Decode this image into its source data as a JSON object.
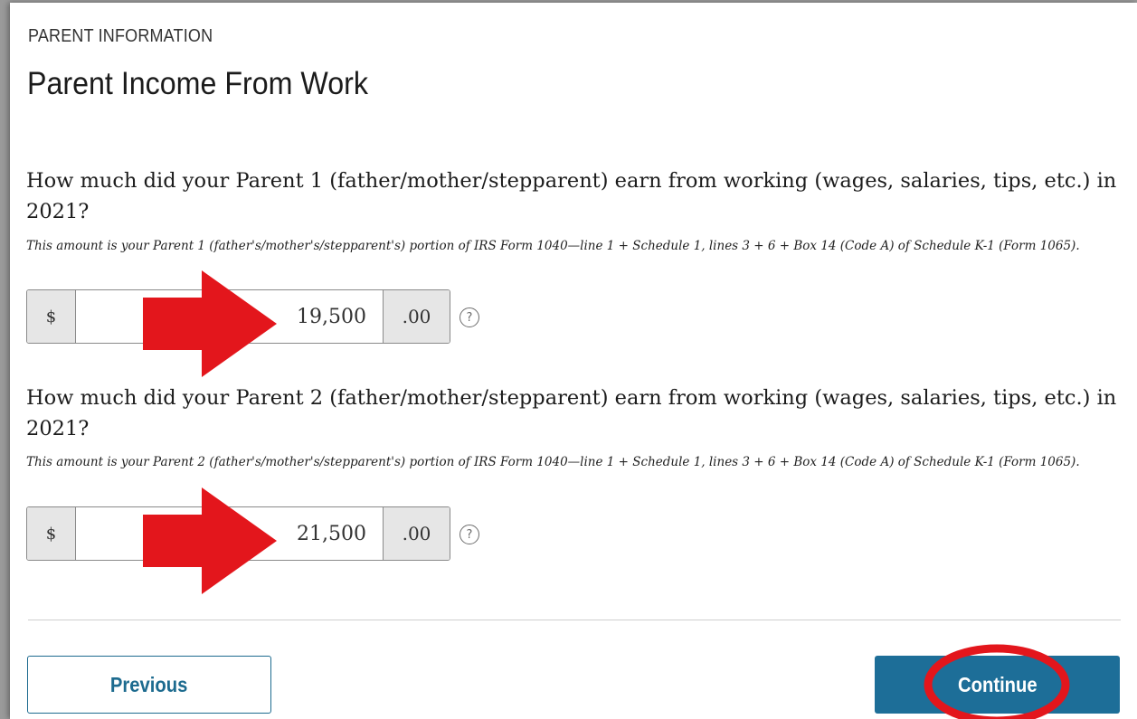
{
  "section_label": "PARENT INFORMATION",
  "page_title": "Parent Income From Work",
  "parent1": {
    "question": "How much did your Parent 1 (father/mother/stepparent) earn from working (wages, salaries, tips, etc.) in 2021?",
    "hint": "This amount is your Parent 1 (father's/mother's/stepparent's) portion of IRS Form 1040—line 1 + Schedule 1, lines 3 + 6 + Box 14 (Code A) of Schedule K-1 (Form 1065).",
    "currency_symbol": "$",
    "amount": "19,500",
    "cents": ".00",
    "help_icon": "?"
  },
  "parent2": {
    "question": "How much did your Parent 2 (father/mother/stepparent) earn from working (wages, salaries, tips, etc.) in 2021?",
    "hint": "This amount is your Parent 2 (father's/mother's/stepparent's) portion of IRS Form 1040—line 1 + Schedule 1, lines 3 + 6 + Box 14 (Code A) of Schedule K-1 (Form 1065).",
    "currency_symbol": "$",
    "amount": "21,500",
    "cents": ".00",
    "help_icon": "?"
  },
  "buttons": {
    "previous": "Previous",
    "continue": "Continue"
  },
  "colors": {
    "primary": "#1d6e98",
    "annotation_red": "#e3161c",
    "addon_bg": "#e6e6e6"
  },
  "annotations": {
    "arrow_icon": "right-arrow-icon",
    "highlight_shape": "ellipse"
  }
}
